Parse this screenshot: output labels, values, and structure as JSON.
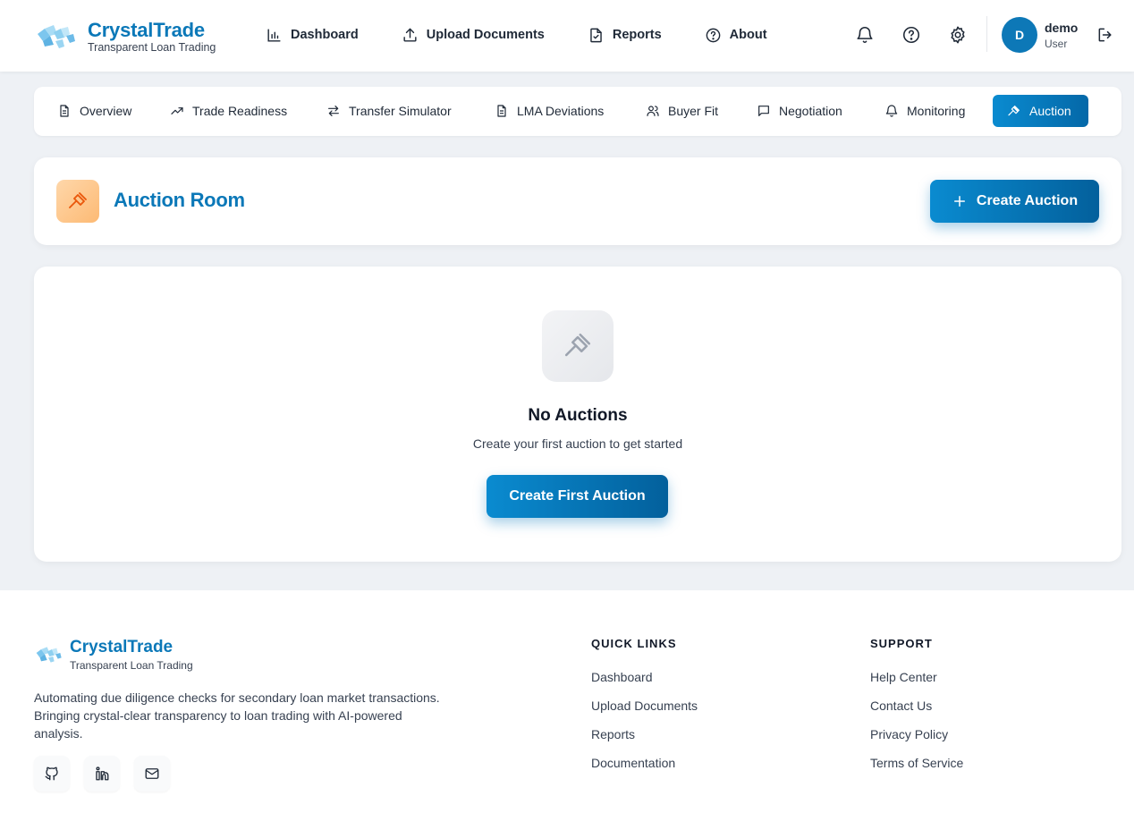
{
  "header": {
    "brand_name": "CrystalTrade",
    "brand_tagline": "Transparent Loan Trading",
    "nav": [
      {
        "label": "Dashboard",
        "icon": "bar-chart-icon"
      },
      {
        "label": "Upload Documents",
        "icon": "upload-icon"
      },
      {
        "label": "Reports",
        "icon": "file-check-icon"
      },
      {
        "label": "About",
        "icon": "help-circle-icon"
      }
    ],
    "icons": [
      "bell-icon",
      "help-circle-icon",
      "gear-icon",
      "logout-icon"
    ],
    "user": {
      "initial": "D",
      "name": "demo",
      "role": "User"
    }
  },
  "tabs": [
    {
      "label": "Overview",
      "icon": "document-icon",
      "active": false
    },
    {
      "label": "Trade Readiness",
      "icon": "trending-up-icon",
      "active": false
    },
    {
      "label": "Transfer Simulator",
      "icon": "arrows-swap-icon",
      "active": false
    },
    {
      "label": "LMA Deviations",
      "icon": "document-icon",
      "active": false
    },
    {
      "label": "Buyer Fit",
      "icon": "users-icon",
      "active": false
    },
    {
      "label": "Negotiation",
      "icon": "message-square-icon",
      "active": false
    },
    {
      "label": "Monitoring",
      "icon": "bell-icon",
      "active": false
    },
    {
      "label": "Auction",
      "icon": "gavel-icon",
      "active": true
    }
  ],
  "auction_room": {
    "title": "Auction Room",
    "create_button": "Create Auction"
  },
  "empty_state": {
    "title": "No Auctions",
    "subtitle": "Create your first auction to get started",
    "button": "Create First Auction"
  },
  "footer": {
    "brand_name": "CrystalTrade",
    "brand_tagline": "Transparent Loan Trading",
    "description": "Automating due diligence checks for secondary loan market transactions. Bringing crystal-clear transparency to loan trading with AI-powered analysis.",
    "social": [
      "github-icon",
      "linkedin-icon",
      "mail-icon"
    ],
    "quick_links": {
      "heading": "QUICK LINKS",
      "links": [
        "Dashboard",
        "Upload Documents",
        "Reports",
        "Documentation"
      ]
    },
    "support": {
      "heading": "SUPPORT",
      "links": [
        "Help Center",
        "Contact Us",
        "Privacy Policy",
        "Terms of Service"
      ]
    }
  },
  "colors": {
    "brand": "#0b78b8",
    "accent_gradient_start": "#0a8bd0",
    "accent_gradient_end": "#03609c",
    "page_bg": "#eef1f5"
  }
}
